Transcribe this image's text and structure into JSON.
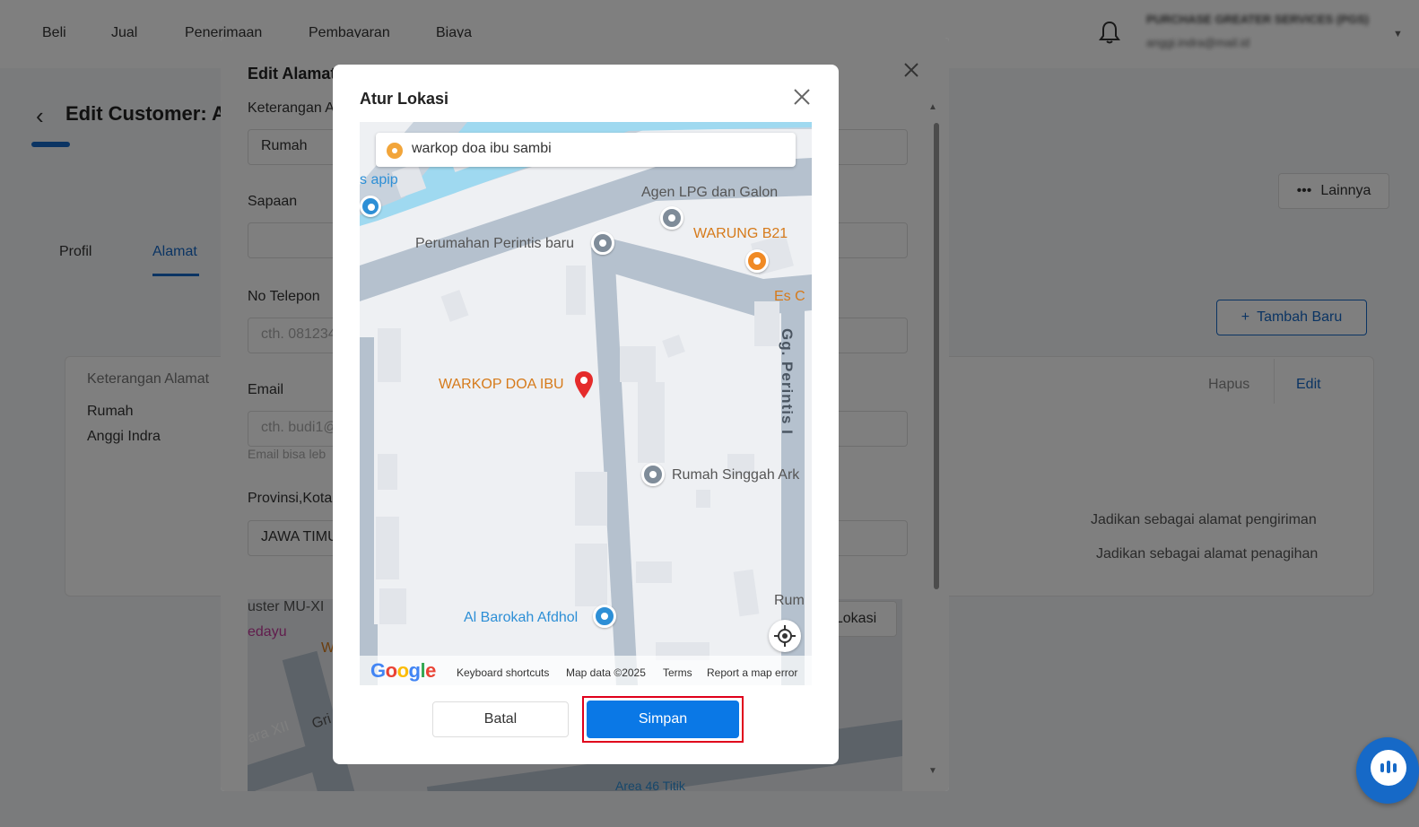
{
  "topnav": {
    "items": [
      "Beli",
      "Jual",
      "Penerimaan",
      "Pembayaran",
      "Biaya"
    ],
    "company_name": "PURCHASE GREATER SERVICES (PGS)",
    "user_email": "anggi.indra@mail.id"
  },
  "page": {
    "title": "Edit Customer: A",
    "lainnya_label": "Lainnya",
    "tabs": [
      "Profil",
      "Alamat"
    ],
    "active_tab": "Alamat",
    "tambah_label": "Tambah Baru"
  },
  "address_card": {
    "label": "Keterangan Alamat",
    "name": "Rumah",
    "contact": "Anggi Indra",
    "hapus": "Hapus",
    "edit": "Edit",
    "shipping_link": "Jadikan sebagai alamat pengiriman",
    "billing_link": "Jadikan sebagai alamat penagihan"
  },
  "edit_modal": {
    "title": "Edit Alamat",
    "fields": {
      "keterangan_label": "Keterangan A",
      "keterangan_value": "Rumah",
      "sapaan_label": "Sapaan",
      "telepon_label": "No Telepon",
      "telepon_placeholder": "cth. 081234",
      "email_label": "Email",
      "email_placeholder": "cth. budi1@",
      "email_hint": "Email bisa leb",
      "provinsi_label": "Provinsi,Kota",
      "provinsi_value": "JAWA TIMUR"
    },
    "map_labels": {
      "a": "uster MU-XI",
      "b": "edayu",
      "c": "W",
      "d": "ara XII",
      "e": "Gri",
      "f": "Area 46 Titik"
    },
    "lokasi_button": "Lokasi"
  },
  "location_modal": {
    "title": "Atur Lokasi",
    "search_value": "warkop doa ibu sambi",
    "map": {
      "poi_apip": "s apip",
      "poi_agen": "Agen LPG dan Galon",
      "poi_perumahan": "Perumahan Perintis baru",
      "poi_warung": "WARUNG B21",
      "poi_es": "Es C",
      "street": "Gg. Perintis I",
      "selected_place": "WARKOP DOA IBU",
      "poi_rumah_singgah": "Rumah Singgah Ark",
      "poi_al_barokah": "Al Barokah Afdhol",
      "poi_rum": "Rum",
      "footer": {
        "shortcuts": "Keyboard shortcuts",
        "map_data": "Map data ©2025",
        "terms": "Terms",
        "report": "Report a map error"
      }
    },
    "cancel_label": "Batal",
    "save_label": "Simpan"
  }
}
